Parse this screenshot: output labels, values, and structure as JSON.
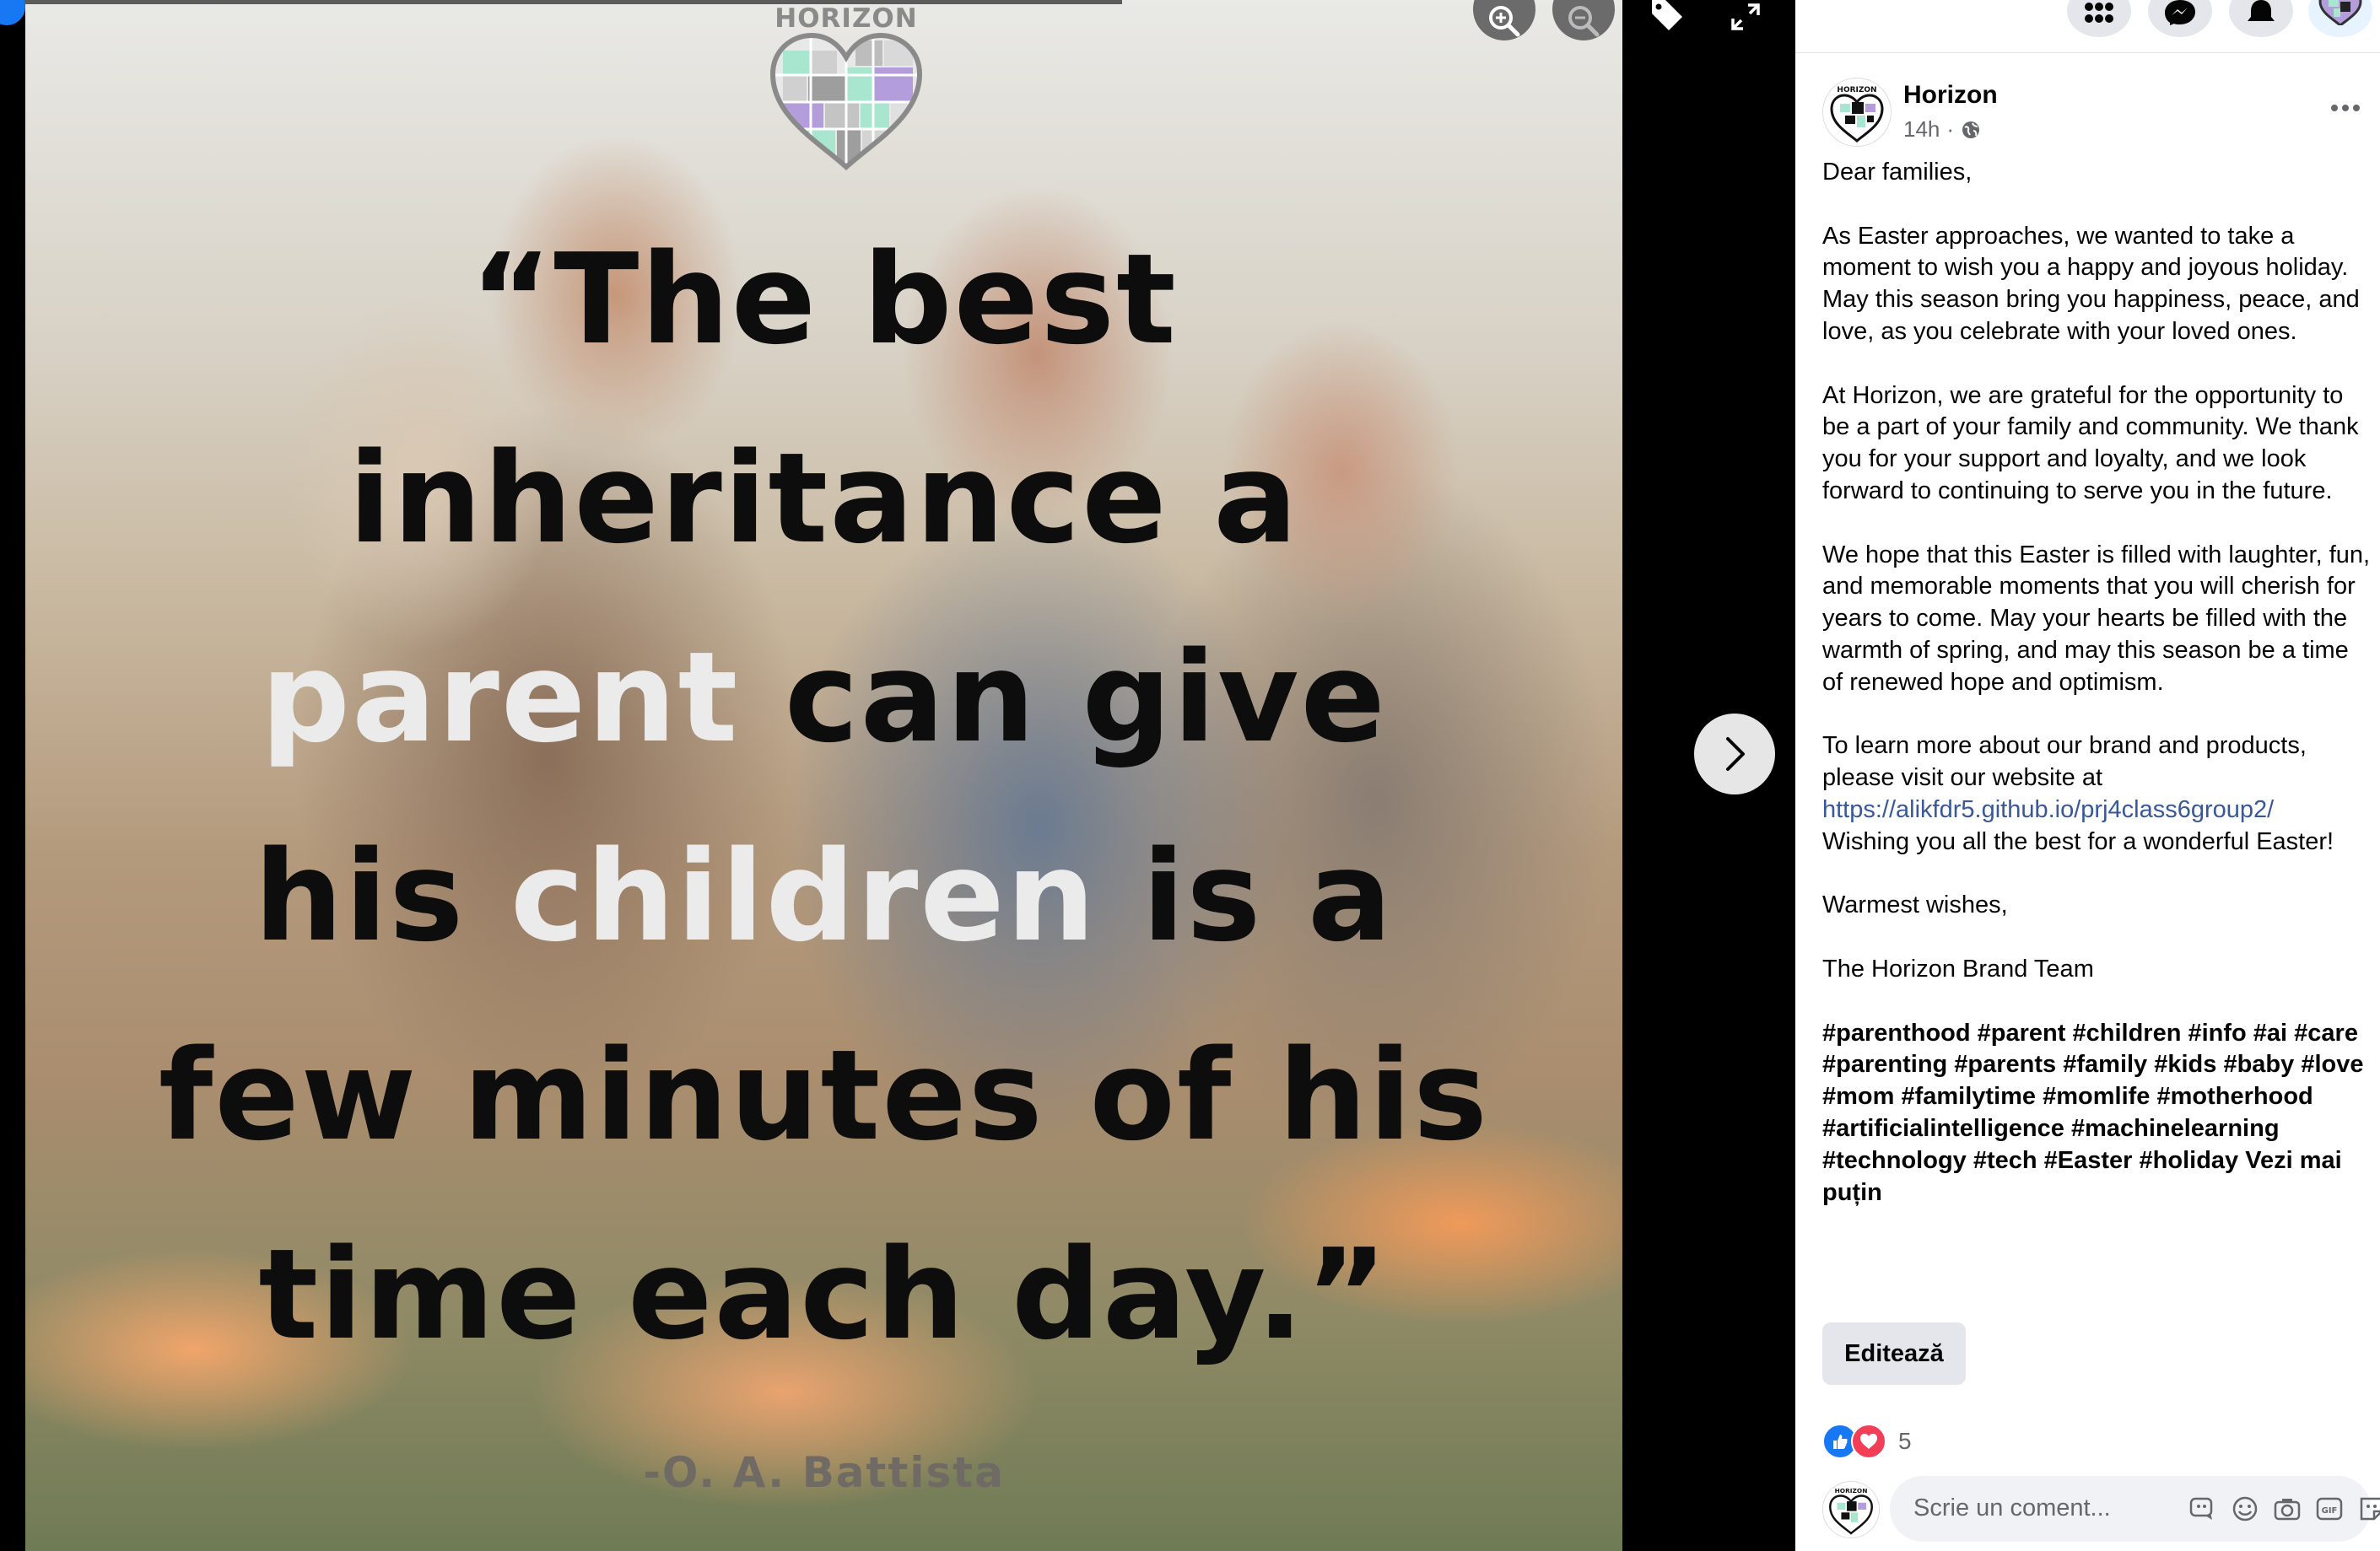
{
  "viewer": {
    "photo_logo_text": "HORIZON",
    "quote_lines": [
      {
        "dark_before": "“The best",
        "light": "",
        "dark_after": ""
      },
      {
        "dark_before": "inheritance a",
        "light": "",
        "dark_after": ""
      },
      {
        "dark_before": "",
        "light": "parent",
        "dark_after": " can give"
      },
      {
        "dark_before": "his ",
        "light": "children",
        "dark_after": " is a"
      },
      {
        "dark_before": "few minutes of his",
        "light": "",
        "dark_after": ""
      },
      {
        "dark_before": "time each day.”",
        "light": "",
        "dark_after": ""
      }
    ],
    "quote_author": "-O. A. Battista",
    "icons": [
      "zoom-in-icon",
      "zoom-out-icon",
      "tag-icon",
      "expand-icon",
      "chevron-right-icon"
    ]
  },
  "topbar": {
    "icons": [
      "menu-grid-icon",
      "messenger-icon",
      "notifications-icon",
      "profile-avatar"
    ]
  },
  "post": {
    "page_name": "Horizon",
    "avatar_text": "HORIZON",
    "time": "14h",
    "separator": "·",
    "audience_icon": "globe-icon",
    "more_icon": "more-options-icon",
    "paragraphs": [
      "Dear families,",
      "As Easter approaches, we wanted to take a moment to wish you a happy and joyous holiday. May this season bring you happiness, peace, and love, as you celebrate with your loved ones.",
      "At Horizon, we are grateful for the opportunity to be a part of your family and community. We thank you for your support and loyalty, and we look forward to continuing to serve you in the future.",
      "We hope that this Easter is filled with laughter, fun, and memorable moments that you will cherish for years to come. May your hearts be filled with the warmth of spring, and may this season be a time of renewed hope and optimism."
    ],
    "visit_text": "To learn more about our brand and products, please visit our website at",
    "link": "https://alikfdr5.github.io/prj4class6group2/",
    "wishing_text": "Wishing you all the best for a wonderful Easter!",
    "closing": "Warmest wishes,",
    "signature": "The Horizon Brand Team",
    "hashtags": "#parenthood #parent #children #info #ai #care #parenting #parents #family #kids #baby #love #mom #familytime #momlife #motherhood #artificialintelligence #machinelearning #technology #tech #Easter #holiday",
    "see_less": "Vezi mai puțin",
    "edit_label": "Editează",
    "reaction_count": "5",
    "reaction_icons": [
      "like-icon",
      "love-icon"
    ],
    "comment_placeholder": "Scrie un coment...",
    "comment_icons": [
      "avatar-sticker-icon",
      "emoji-icon",
      "camera-icon",
      "gif-icon",
      "sticker-icon"
    ]
  },
  "colors": {
    "accent_blue": "#1877f2",
    "link": "#385898",
    "love_red": "#f33e58",
    "logo_green": "#a8e6cf",
    "logo_purple": "#b39ddb"
  }
}
